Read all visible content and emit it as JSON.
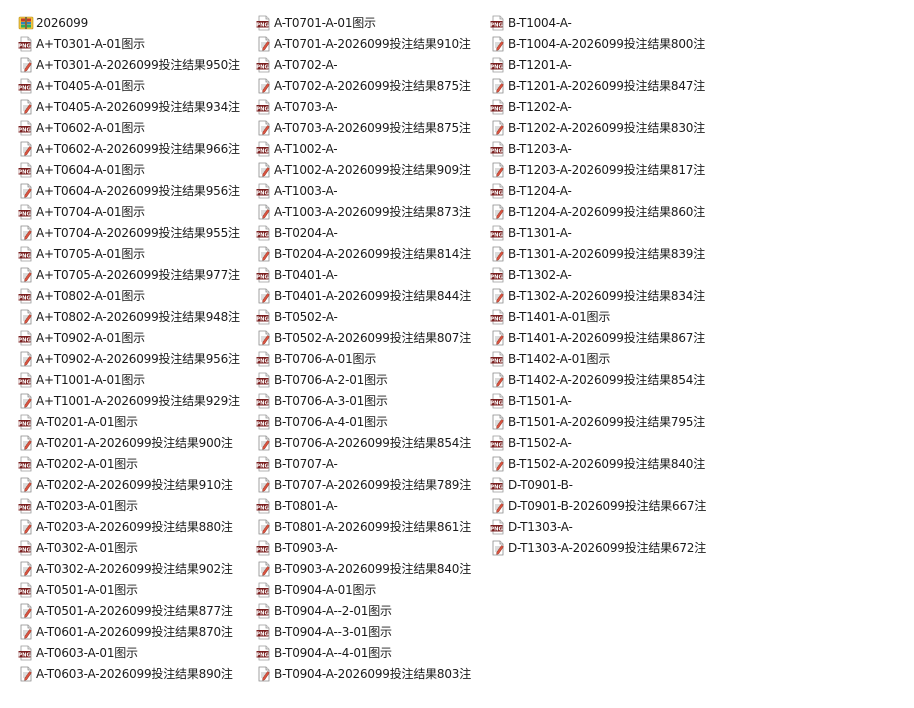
{
  "icon_types": {
    "folder": "zip-folder-icon",
    "png": "png-image-icon",
    "txt": "text-document-icon"
  },
  "colors": {
    "png_badge": "#7a1f1f",
    "folder_yellow": "#f2c53d",
    "text_blue": "#2b61c9"
  },
  "columns": [
    [
      {
        "name": "2026099",
        "icon": "folder"
      },
      {
        "name": "A+T0301-A-01图示",
        "icon": "png"
      },
      {
        "name": "A+T0301-A-2026099投注结果950注",
        "icon": "txt"
      },
      {
        "name": "A+T0405-A-01图示",
        "icon": "png"
      },
      {
        "name": "A+T0405-A-2026099投注结果934注",
        "icon": "txt"
      },
      {
        "name": "A+T0602-A-01图示",
        "icon": "png"
      },
      {
        "name": "A+T0602-A-2026099投注结果966注",
        "icon": "txt"
      },
      {
        "name": "A+T0604-A-01图示",
        "icon": "png"
      },
      {
        "name": "A+T0604-A-2026099投注结果956注",
        "icon": "txt"
      },
      {
        "name": "A+T0704-A-01图示",
        "icon": "png"
      },
      {
        "name": "A+T0704-A-2026099投注结果955注",
        "icon": "txt"
      },
      {
        "name": "A+T0705-A-01图示",
        "icon": "png"
      },
      {
        "name": "A+T0705-A-2026099投注结果977注",
        "icon": "txt"
      },
      {
        "name": "A+T0802-A-01图示",
        "icon": "png"
      },
      {
        "name": "A+T0802-A-2026099投注结果948注",
        "icon": "txt"
      },
      {
        "name": "A+T0902-A-01图示",
        "icon": "png"
      },
      {
        "name": "A+T0902-A-2026099投注结果956注",
        "icon": "txt"
      },
      {
        "name": "A+T1001-A-01图示",
        "icon": "png"
      },
      {
        "name": "A+T1001-A-2026099投注结果929注",
        "icon": "txt"
      },
      {
        "name": "A-T0201-A-01图示",
        "icon": "png"
      },
      {
        "name": "A-T0201-A-2026099投注结果900注",
        "icon": "txt"
      },
      {
        "name": "A-T0202-A-01图示",
        "icon": "png"
      },
      {
        "name": "A-T0202-A-2026099投注结果910注",
        "icon": "txt"
      },
      {
        "name": "A-T0203-A-01图示",
        "icon": "png"
      },
      {
        "name": "A-T0203-A-2026099投注结果880注",
        "icon": "txt"
      },
      {
        "name": "A-T0302-A-01图示",
        "icon": "png"
      },
      {
        "name": "A-T0302-A-2026099投注结果902注",
        "icon": "txt"
      },
      {
        "name": "A-T0501-A-01图示",
        "icon": "png"
      },
      {
        "name": "A-T0501-A-2026099投注结果877注",
        "icon": "txt"
      },
      {
        "name": "A-T0601-A-2026099投注结果870注",
        "icon": "txt"
      },
      {
        "name": "A-T0603-A-01图示",
        "icon": "png"
      },
      {
        "name": "A-T0603-A-2026099投注结果890注",
        "icon": "txt"
      }
    ],
    [
      {
        "name": "A-T0701-A-01图示",
        "icon": "png"
      },
      {
        "name": "A-T0701-A-2026099投注结果910注",
        "icon": "txt"
      },
      {
        "name": "A-T0702-A-",
        "icon": "png"
      },
      {
        "name": "A-T0702-A-2026099投注结果875注",
        "icon": "txt"
      },
      {
        "name": "A-T0703-A-",
        "icon": "png"
      },
      {
        "name": "A-T0703-A-2026099投注结果875注",
        "icon": "txt"
      },
      {
        "name": "A-T1002-A-",
        "icon": "png"
      },
      {
        "name": "A-T1002-A-2026099投注结果909注",
        "icon": "txt"
      },
      {
        "name": "A-T1003-A-",
        "icon": "png"
      },
      {
        "name": "A-T1003-A-2026099投注结果873注",
        "icon": "txt"
      },
      {
        "name": "B-T0204-A-",
        "icon": "png"
      },
      {
        "name": "B-T0204-A-2026099投注结果814注",
        "icon": "txt"
      },
      {
        "name": "B-T0401-A-",
        "icon": "png"
      },
      {
        "name": "B-T0401-A-2026099投注结果844注",
        "icon": "txt"
      },
      {
        "name": "B-T0502-A-",
        "icon": "png"
      },
      {
        "name": "B-T0502-A-2026099投注结果807注",
        "icon": "txt"
      },
      {
        "name": "B-T0706-A-01图示",
        "icon": "png"
      },
      {
        "name": "B-T0706-A-2-01图示",
        "icon": "png"
      },
      {
        "name": "B-T0706-A-3-01图示",
        "icon": "png"
      },
      {
        "name": "B-T0706-A-4-01图示",
        "icon": "png"
      },
      {
        "name": "B-T0706-A-2026099投注结果854注",
        "icon": "txt"
      },
      {
        "name": "B-T0707-A-",
        "icon": "png"
      },
      {
        "name": "B-T0707-A-2026099投注结果789注",
        "icon": "txt"
      },
      {
        "name": "B-T0801-A-",
        "icon": "png"
      },
      {
        "name": "B-T0801-A-2026099投注结果861注",
        "icon": "txt"
      },
      {
        "name": "B-T0903-A-",
        "icon": "png"
      },
      {
        "name": "B-T0903-A-2026099投注结果840注",
        "icon": "txt"
      },
      {
        "name": "B-T0904-A-01图示",
        "icon": "png"
      },
      {
        "name": "B-T0904-A--2-01图示",
        "icon": "png"
      },
      {
        "name": "B-T0904-A--3-01图示",
        "icon": "png"
      },
      {
        "name": "B-T0904-A--4-01图示",
        "icon": "png"
      },
      {
        "name": "B-T0904-A-2026099投注结果803注",
        "icon": "txt"
      }
    ],
    [
      {
        "name": "B-T1004-A-",
        "icon": "png"
      },
      {
        "name": "B-T1004-A-2026099投注结果800注",
        "icon": "txt"
      },
      {
        "name": "B-T1201-A-",
        "icon": "png"
      },
      {
        "name": "B-T1201-A-2026099投注结果847注",
        "icon": "txt"
      },
      {
        "name": "B-T1202-A-",
        "icon": "png"
      },
      {
        "name": "B-T1202-A-2026099投注结果830注",
        "icon": "txt"
      },
      {
        "name": "B-T1203-A-",
        "icon": "png"
      },
      {
        "name": "B-T1203-A-2026099投注结果817注",
        "icon": "txt"
      },
      {
        "name": "B-T1204-A-",
        "icon": "png"
      },
      {
        "name": "B-T1204-A-2026099投注结果860注",
        "icon": "txt"
      },
      {
        "name": "B-T1301-A-",
        "icon": "png"
      },
      {
        "name": "B-T1301-A-2026099投注结果839注",
        "icon": "txt"
      },
      {
        "name": "B-T1302-A-",
        "icon": "png"
      },
      {
        "name": "B-T1302-A-2026099投注结果834注",
        "icon": "txt"
      },
      {
        "name": "B-T1401-A-01图示",
        "icon": "png"
      },
      {
        "name": "B-T1401-A-2026099投注结果867注",
        "icon": "txt"
      },
      {
        "name": "B-T1402-A-01图示",
        "icon": "png"
      },
      {
        "name": "B-T1402-A-2026099投注结果854注",
        "icon": "txt"
      },
      {
        "name": "B-T1501-A-",
        "icon": "png"
      },
      {
        "name": "B-T1501-A-2026099投注结果795注",
        "icon": "txt"
      },
      {
        "name": "B-T1502-A-",
        "icon": "png"
      },
      {
        "name": "B-T1502-A-2026099投注结果840注",
        "icon": "txt"
      },
      {
        "name": "D-T0901-B-",
        "icon": "png"
      },
      {
        "name": "D-T0901-B-2026099投注结果667注",
        "icon": "txt"
      },
      {
        "name": "D-T1303-A-",
        "icon": "png"
      },
      {
        "name": "D-T1303-A-2026099投注结果672注",
        "icon": "txt"
      }
    ]
  ]
}
